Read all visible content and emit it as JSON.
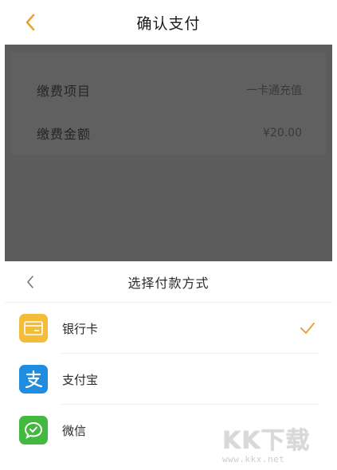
{
  "header": {
    "title": "确认支付",
    "back_icon": "chevron-left-icon",
    "accent_color": "#e8a23a"
  },
  "payment_info": {
    "item_label": "缴费项目",
    "item_value": "一卡通充值",
    "amount_label": "缴费金额",
    "amount_value": "¥20.00"
  },
  "sheet": {
    "title": "选择付款方式",
    "back_icon": "chevron-left-icon",
    "methods": [
      {
        "label": "银行卡",
        "icon": "bank-card-icon",
        "color": "#f3bd3a",
        "selected": true
      },
      {
        "label": "支付宝",
        "icon": "alipay-icon",
        "color": "#1f8ce0",
        "selected": false
      },
      {
        "label": "微信",
        "icon": "wechat-icon",
        "color": "#43b83f",
        "selected": false
      }
    ],
    "check_color": "#e8a23a"
  },
  "watermark": {
    "logo": "KK下载",
    "url": "www.kkx.net"
  }
}
